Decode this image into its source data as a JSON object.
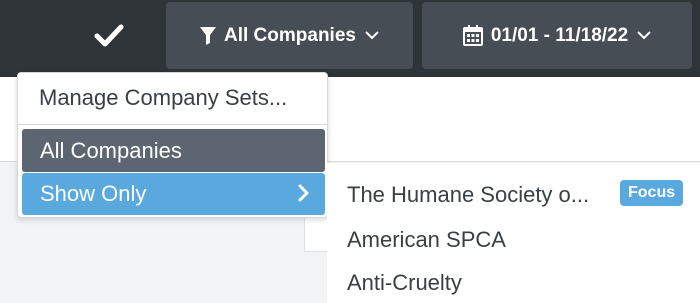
{
  "toolbar": {
    "check_icon": "checkmark-icon",
    "filter": {
      "icon": "filter-icon",
      "label": "All Companies",
      "chevron": "chevron-down-icon"
    },
    "date_range": {
      "icon": "calendar-icon",
      "label": "01/01 - 11/18/22",
      "chevron": "chevron-down-icon"
    }
  },
  "dropdown": {
    "manage_label": "Manage Company Sets...",
    "items": [
      {
        "label": "All Companies",
        "state": "selected"
      },
      {
        "label": "Show Only",
        "state": "highlighted",
        "arrow_icon": "chevron-right-icon"
      }
    ]
  },
  "submenu": {
    "items": [
      {
        "label": "The Humane Society o...",
        "badge": "Focus"
      },
      {
        "label": "American SPCA"
      },
      {
        "label": "Anti-Cruelty"
      }
    ]
  },
  "colors": {
    "topbar_bg": "#2f3439",
    "pill_bg": "#464d55",
    "selected_bg": "#5d6670",
    "highlight_bg": "#59a9df",
    "badge_bg": "#59a9df"
  }
}
